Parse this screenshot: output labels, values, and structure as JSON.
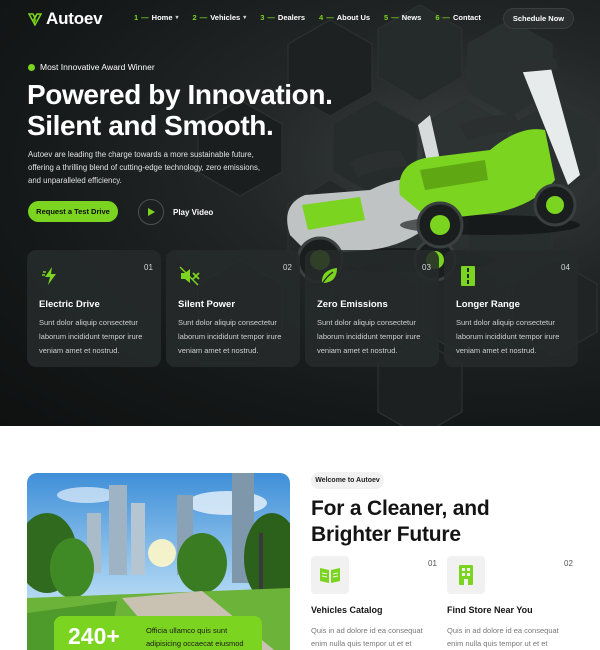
{
  "brand": {
    "name": "Autoev",
    "accent": "#7bd41f",
    "dark": "#151818"
  },
  "nav": {
    "items": [
      {
        "num": "1",
        "label": "Home",
        "has_dropdown": true
      },
      {
        "num": "2",
        "label": "Vehicles",
        "has_dropdown": true
      },
      {
        "num": "3",
        "label": "Dealers",
        "has_dropdown": false
      },
      {
        "num": "4",
        "label": "About Us",
        "has_dropdown": false
      },
      {
        "num": "5",
        "label": "News",
        "has_dropdown": false
      },
      {
        "num": "6",
        "label": "Contact",
        "has_dropdown": false
      }
    ],
    "dash": "—",
    "cta": "Schedule Now"
  },
  "hero": {
    "award": "Most Innovative Award Winner",
    "title_line1": "Powered by Innovation.",
    "title_line2": "Silent and Smooth.",
    "description": "Autoev are leading the charge towards a more sustainable future, offering a thrilling blend of cutting-edge technology, zero emissions, and unparalleled efficiency.",
    "cta": "Request a Test Drive",
    "play_label": "Play Video"
  },
  "features": [
    {
      "num": "01",
      "title": "Electric Drive",
      "desc": "Sunt dolor aliquip consectetur laborum incididunt tempor irure veniam amet et nostrud.",
      "icon": "bolt-icon"
    },
    {
      "num": "02",
      "title": "Silent Power",
      "desc": "Sunt dolor aliquip consectetur laborum incididunt tempor irure veniam amet et nostrud.",
      "icon": "mute-speaker-icon"
    },
    {
      "num": "03",
      "title": "Zero Emissions",
      "desc": "Sunt dolor aliquip consectetur laborum incididunt tempor irure veniam amet et nostrud.",
      "icon": "leaf-icon"
    },
    {
      "num": "04",
      "title": "Longer Range",
      "desc": "Sunt dolor aliquip consectetur laborum incididunt tempor irure veniam amet et nostrud.",
      "icon": "road-icon"
    }
  ],
  "about": {
    "badge": "Welcome to Autoev",
    "title_line1": "For a Cleaner, and",
    "title_line2": "Brighter Future",
    "stat_value": "240+",
    "stat_text": "Officia ullamco quis sunt adipisicing occaecat eiusmod",
    "items": [
      {
        "num": "01",
        "title": "Vehicles Catalog",
        "desc": "Quis in ad dolore id ea consequat enim nulla quis tempor ut et et",
        "icon": "catalog-book-icon"
      },
      {
        "num": "02",
        "title": "Find Store Near You",
        "desc": "Quis in ad dolore id ea consequat enim nulla quis tempor ut et et",
        "icon": "store-building-icon"
      }
    ]
  }
}
